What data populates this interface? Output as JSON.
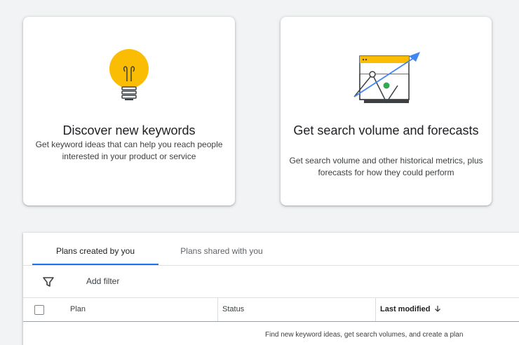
{
  "cards": {
    "discover": {
      "title": "Discover new keywords",
      "description": "Get keyword ideas that can help you reach people interested in your product or service",
      "icon": "lightbulb-icon"
    },
    "forecast": {
      "title": "Get search volume and forecasts",
      "description": "Get search volume and other historical metrics, plus forecasts for how they could perform",
      "icon": "chart-trend-icon"
    }
  },
  "plans": {
    "tabs": [
      {
        "label": "Plans created by you",
        "active": true
      },
      {
        "label": "Plans shared with you",
        "active": false
      }
    ],
    "filter": {
      "icon": "filter-icon",
      "label": "Add filter"
    },
    "columns": {
      "plan": "Plan",
      "status": "Status",
      "last_modified": "Last modified"
    },
    "sort_icon": "arrow-down-icon",
    "empty_message": "Find new keyword ideas, get search volumes, and create a plan"
  },
  "colors": {
    "accent": "#1a73e8",
    "bulb_yellow": "#fbbc04",
    "green": "#34a853"
  }
}
